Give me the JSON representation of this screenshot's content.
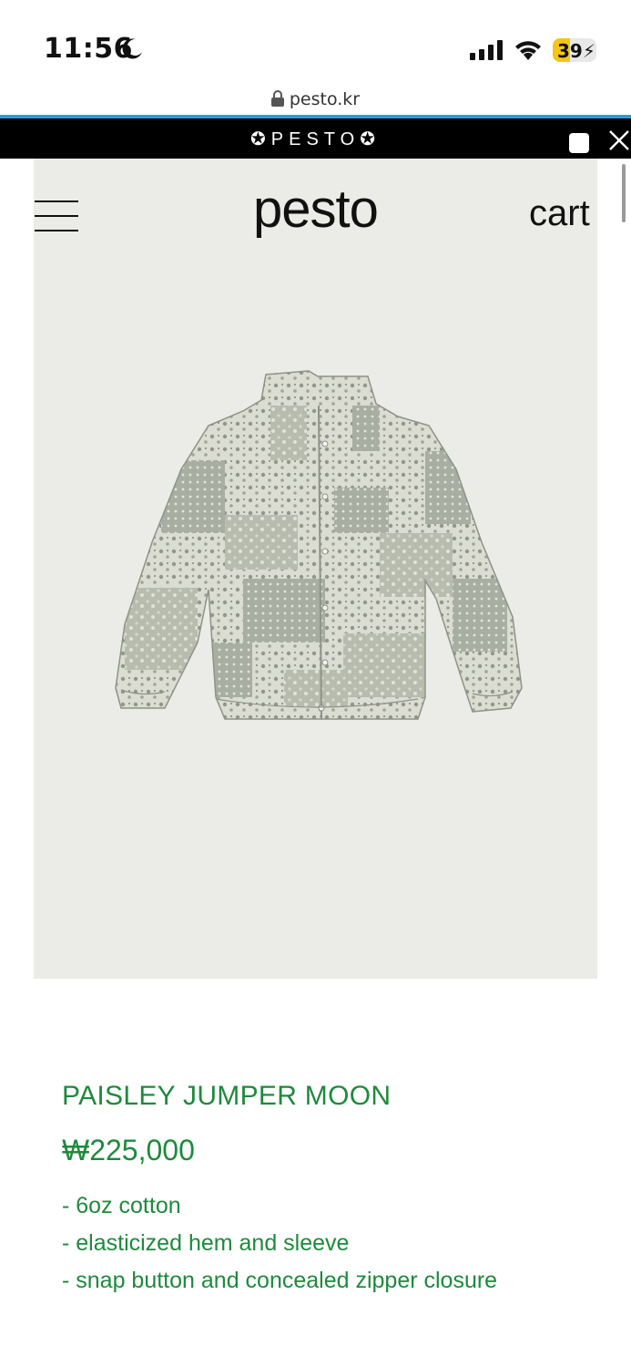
{
  "status_bar": {
    "time": "11:56",
    "battery": "39",
    "battery_level": 0.39,
    "moon_icon": "moon-icon",
    "signal_icon": "cellular-signal-icon",
    "wifi_icon": "wifi-icon"
  },
  "browser": {
    "url": "pesto.kr",
    "lock_icon": "lock-icon"
  },
  "announcement": {
    "text": "✪PESTO✪",
    "close_icon": "close-icon"
  },
  "header": {
    "logo": "pesto",
    "cart_label": "cart",
    "menu_icon": "hamburger-menu-icon"
  },
  "product": {
    "name": "PAISLEY JUMPER MOON",
    "price": "₩225,000",
    "details": [
      "- 6oz cotton",
      "- elasticized hem and sleeve",
      "- snap button and concealed zipper closure"
    ]
  },
  "colors": {
    "accent_green": "#1e8a3c",
    "hero_bg": "#ebebe7",
    "announce_bg": "#000000",
    "progress_blue": "#2b9be0"
  }
}
